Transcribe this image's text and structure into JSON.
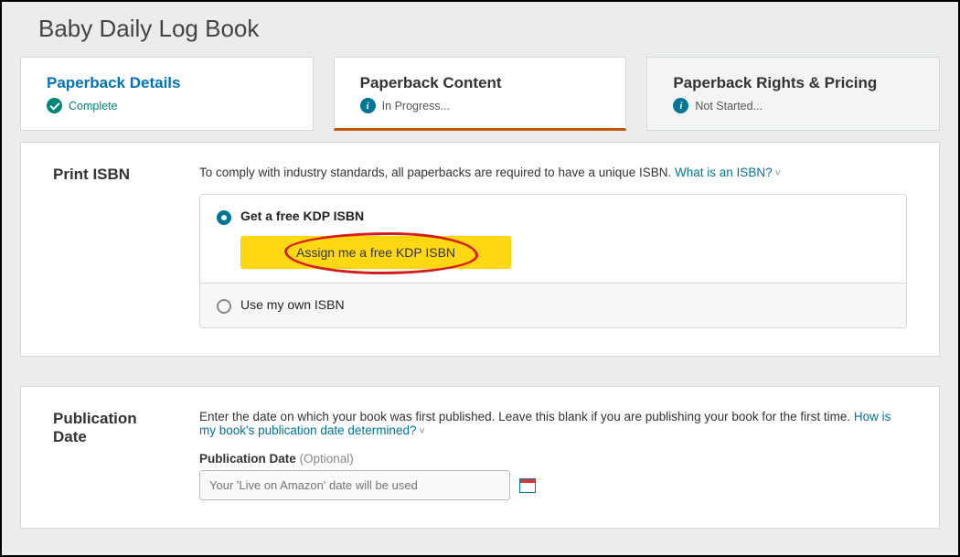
{
  "page_title": "Baby Daily Log Book",
  "tabs": [
    {
      "title": "Paperback Details",
      "status": "Complete"
    },
    {
      "title": "Paperback Content",
      "status": "In Progress..."
    },
    {
      "title": "Paperback Rights & Pricing",
      "status": "Not Started..."
    }
  ],
  "isbn": {
    "section_heading": "Print ISBN",
    "description": "To comply with industry standards, all paperbacks are required to have a unique ISBN. ",
    "help_link": "What is an ISBN?",
    "option_free": "Get a free KDP ISBN",
    "assign_button": "Assign me a free KDP ISBN",
    "option_own": "Use my own ISBN"
  },
  "pub_date": {
    "section_heading": "Publication Date",
    "description_part1": "Enter the date on which your book was first published. Leave this blank if you are publishing your book for the first time. ",
    "help_link": "How is my book's publication date determined?",
    "field_label": "Publication Date",
    "field_optional": " (Optional)",
    "placeholder": "Your 'Live on Amazon' date will be used"
  }
}
